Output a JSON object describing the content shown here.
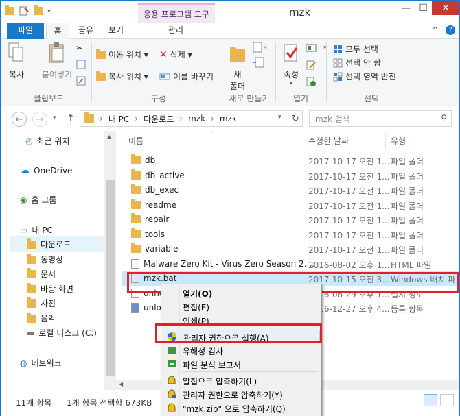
{
  "window": {
    "title": "mzk",
    "contextual_tab": "응용 프로그램 도구",
    "contextual_sub_tab": "관리",
    "minimize": "—",
    "maximize": "☐",
    "close": "✕"
  },
  "tabs": {
    "file": "파일",
    "home": "홈",
    "share": "공유",
    "view": "보기",
    "collapse": "^",
    "help": "?"
  },
  "ribbon": {
    "clipboard": {
      "copy": "복사",
      "paste": "붙여넣기",
      "label": "클립보드"
    },
    "organize": {
      "move_to": "이동 위치 ▾",
      "copy_to": "복사 위치 ▾",
      "delete": "삭제 ▾",
      "rename": "이름 바꾸기",
      "label": "구성"
    },
    "new": {
      "new_folder_line1": "새",
      "new_folder_line2": "폴더",
      "label": "새로 만들기"
    },
    "open": {
      "properties": "속성",
      "properties_arrow": "▾",
      "label": "열기"
    },
    "select": {
      "select_all": "모두 선택",
      "select_none": "선택 안 함",
      "invert": "선택 영역 반전",
      "label": "선택"
    }
  },
  "address": {
    "back": "←",
    "forward": "→",
    "recent": "▾",
    "up": "↑",
    "crumbs": [
      "내 PC",
      "다운로드",
      "mzk",
      "mzk"
    ],
    "dropdown": "▾",
    "refresh": "↻",
    "search_placeholder": "mzk 검색"
  },
  "nav_pane": {
    "items": [
      "최근 위치",
      "OneDrive",
      "홈 그룹",
      "내 PC",
      "다운로드",
      "동영상",
      "문서",
      "바탕 화면",
      "사진",
      "음악",
      "로컬 디스크 (C:)",
      "네트워크"
    ]
  },
  "columns": {
    "name": "이름",
    "date": "수정한 날짜",
    "type": "유형"
  },
  "files": [
    {
      "name": "db",
      "date": "2017-10-17 오전 1...",
      "type": "파일 폴더",
      "icon": "folder"
    },
    {
      "name": "db_active",
      "date": "2017-10-17 오전 1...",
      "type": "파일 폴더",
      "icon": "folder"
    },
    {
      "name": "db_exec",
      "date": "2017-10-17 오전 1...",
      "type": "파일 폴더",
      "icon": "folder"
    },
    {
      "name": "readme",
      "date": "2017-10-17 오전 1...",
      "type": "파일 폴더",
      "icon": "folder"
    },
    {
      "name": "repair",
      "date": "2017-10-17 오전 1...",
      "type": "파일 폴더",
      "icon": "folder"
    },
    {
      "name": "tools",
      "date": "2017-10-17 오전 1...",
      "type": "파일 폴더",
      "icon": "folder"
    },
    {
      "name": "variable",
      "date": "2017-10-17 오전 1...",
      "type": "파일 폴더",
      "icon": "folder"
    },
    {
      "name": "Malware Zero Kit - Virus Zero Season 2....",
      "date": "2016-08-02 오후 1...",
      "type": "HTML 파일",
      "icon": "html"
    },
    {
      "name": "mzk.bat",
      "date": "2017-10-15 오전 3...",
      "type": "Windows 배치 파",
      "icon": "bat"
    },
    {
      "name": "unho",
      "date": "2016-06-29 오후 1...",
      "type": "설치 정보",
      "icon": "inf"
    },
    {
      "name": "unlo",
      "date": "2016-12-27 오후 4...",
      "type": "등록 항목",
      "icon": "reg"
    }
  ],
  "context_menu": {
    "items": [
      "열기(O)",
      "편집(E)",
      "인쇄(P)",
      "관리자 권한으로 실행(A)",
      "유해성 검사",
      "파일 분석 보고서",
      "알집으로 압축하기(L)",
      "관리자 권한으로 압축하기(Y)",
      "\"mzk.zip\" 으로 압축하기(Q)"
    ]
  },
  "status": {
    "count": "11개 항목",
    "selection": "1개 항목 선택함 673KB"
  },
  "colors": {
    "accent": "#1979ca",
    "highlight": "#e1202b",
    "selection": "#cce8ff"
  }
}
